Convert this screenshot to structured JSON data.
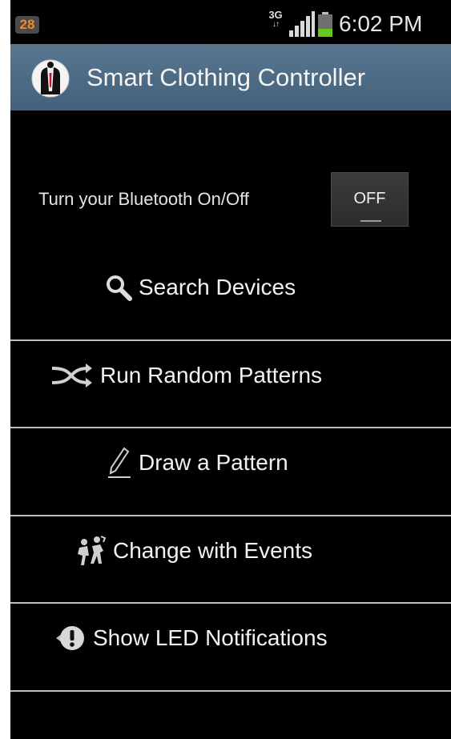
{
  "status_bar": {
    "notification_count": "28",
    "network_type": "3G",
    "time": "6:02 PM",
    "icons": [
      "notification-badge-icon",
      "3g-data-icon",
      "signal-strength-icon",
      "battery-icon"
    ],
    "battery_color": "#64c81e"
  },
  "action_bar": {
    "title": "Smart Clothing Controller",
    "icon": "tuxedo-icon",
    "background_color": "#4f6d87"
  },
  "bluetooth": {
    "label": "Turn your Bluetooth On/Off",
    "toggle_label": "OFF"
  },
  "menu": {
    "items": [
      {
        "label": "Search Devices",
        "icon": "search-icon"
      },
      {
        "label": "Run Random Patterns",
        "icon": "shuffle-icon"
      },
      {
        "label": "Draw a Pattern",
        "icon": "pencil-icon"
      },
      {
        "label": "Change with Events",
        "icon": "dancing-people-icon"
      },
      {
        "label": "Show LED Notifications",
        "icon": "exclamation-icon"
      }
    ]
  }
}
